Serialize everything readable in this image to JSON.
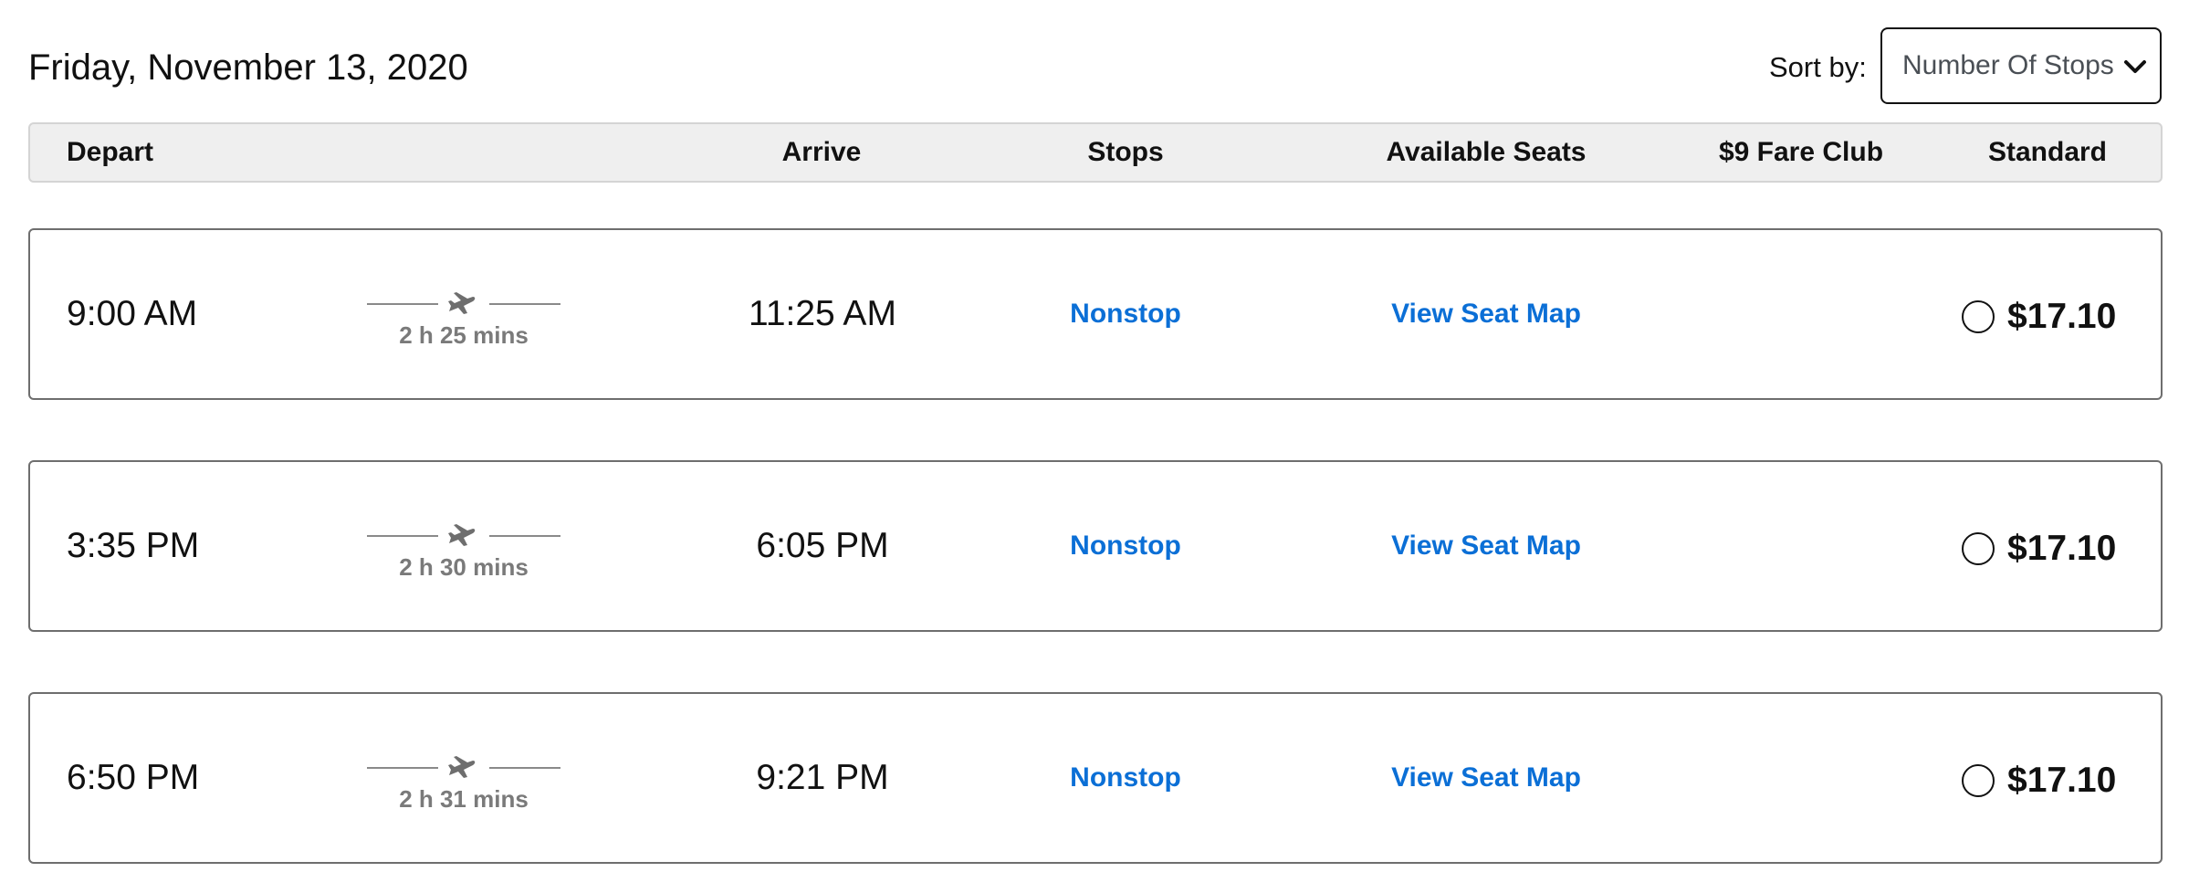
{
  "header": {
    "date": "Friday, November 13, 2020",
    "sort_label": "Sort by:",
    "sort_value": "Number Of Stops"
  },
  "columns": {
    "depart": "Depart",
    "arrive": "Arrive",
    "stops": "Stops",
    "available_seats": "Available Seats",
    "fare_club": "$9 Fare Club",
    "standard": "Standard"
  },
  "flights": [
    {
      "depart": "9:00 AM",
      "duration": "2 h 25 mins",
      "arrive": "11:25 AM",
      "stops": "Nonstop",
      "seat_map": "View Seat Map",
      "standard_price": "$17.10"
    },
    {
      "depart": "3:35 PM",
      "duration": "2 h 30 mins",
      "arrive": "6:05 PM",
      "stops": "Nonstop",
      "seat_map": "View Seat Map",
      "standard_price": "$17.10"
    },
    {
      "depart": "6:50 PM",
      "duration": "2 h 31 mins",
      "arrive": "9:21 PM",
      "stops": "Nonstop",
      "seat_map": "View Seat Map",
      "standard_price": "$17.10"
    }
  ],
  "icons": {
    "sort_chevron": "chevron-down-icon",
    "plane": "plane-icon",
    "radio": "radio-unselected-icon"
  },
  "colors": {
    "link": "#0b6fd6",
    "header_bg": "#efefef",
    "duration_text": "#7a7a7a"
  }
}
